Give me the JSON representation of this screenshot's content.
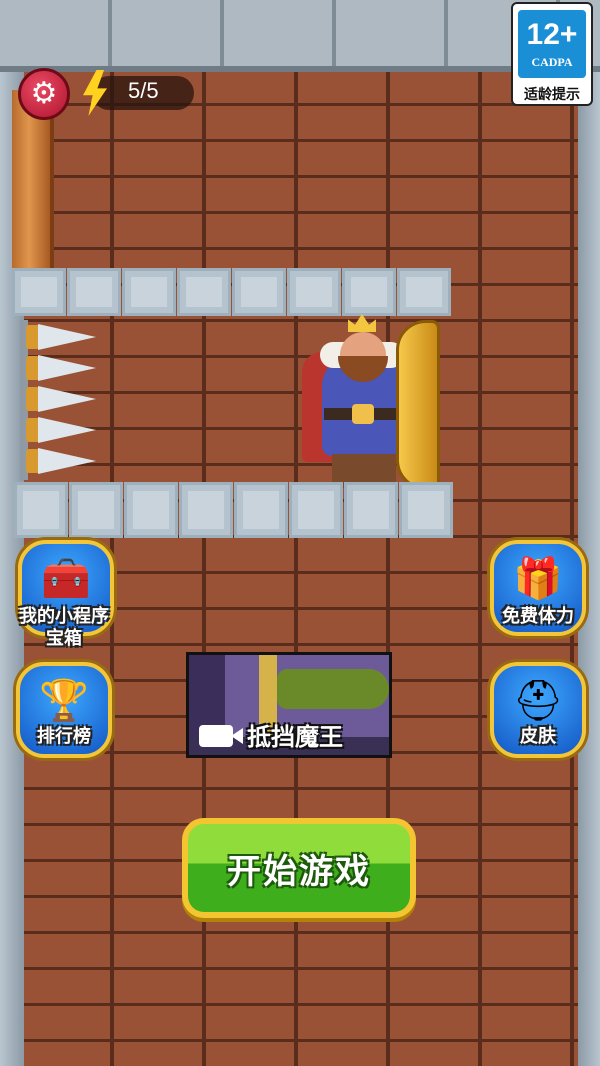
{
  "hud": {
    "energy": "5/5"
  },
  "age_rating": {
    "number": "12+",
    "org": "CADPA",
    "label": "适龄提示"
  },
  "side_buttons": {
    "chest": {
      "label": "我的小程序\n宝箱",
      "icon": "treasure-chest-icon"
    },
    "gift": {
      "label": "免费体力",
      "icon": "gift-box-icon"
    },
    "trophy": {
      "label": "排行榜",
      "icon": "trophy-icon"
    },
    "skin": {
      "label": "皮肤",
      "icon": "helmet-icon"
    }
  },
  "video_card": {
    "title": "抵挡魔王",
    "icon": "video-camera-icon"
  },
  "start": {
    "label": "开始游戏"
  },
  "colors": {
    "gear": "#c81e3c",
    "energy": "#ffd21f",
    "button_blue": "#1e7ae8",
    "button_gold": "#f3c63a",
    "start_green": "#5cc428"
  }
}
